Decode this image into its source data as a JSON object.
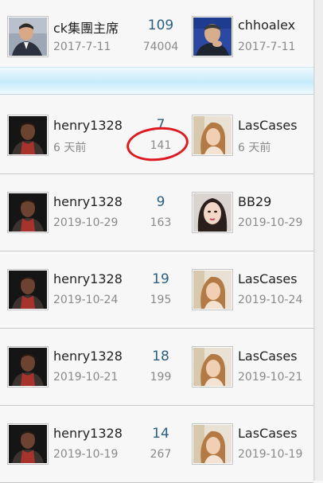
{
  "topics": [
    {
      "author": "ck集團主席",
      "author_date": "2017-7-11",
      "replies": "109",
      "views": "74004",
      "last_poster": "chhoalex",
      "last_date": "2017-7-11",
      "author_avatar": "businessman-avatar",
      "last_avatar": "businessman-hand-on-chin-avatar"
    },
    {
      "author": "henry1328",
      "author_date": "6 天前",
      "replies": "7",
      "views": "141",
      "last_poster": "LasCases",
      "last_date": "6 天前",
      "author_avatar": "man-avatar",
      "last_avatar": "woman-avatar"
    },
    {
      "author": "henry1328",
      "author_date": "2019-10-29",
      "replies": "9",
      "views": "163",
      "last_poster": "BB29",
      "last_date": "2019-10-29",
      "author_avatar": "man-avatar",
      "last_avatar": "woman-portrait-avatar"
    },
    {
      "author": "henry1328",
      "author_date": "2019-10-24",
      "replies": "19",
      "views": "195",
      "last_poster": "LasCases",
      "last_date": "2019-10-24",
      "author_avatar": "man-avatar",
      "last_avatar": "woman-avatar"
    },
    {
      "author": "henry1328",
      "author_date": "2019-10-21",
      "replies": "18",
      "views": "199",
      "last_poster": "LasCases",
      "last_date": "2019-10-21",
      "author_avatar": "man-avatar",
      "last_avatar": "woman-avatar"
    },
    {
      "author": "henry1328",
      "author_date": "2019-10-19",
      "replies": "14",
      "views": "267",
      "last_poster": "LasCases",
      "last_date": "2019-10-19",
      "author_avatar": "man-avatar",
      "last_avatar": "woman-avatar"
    }
  ],
  "colors": {
    "reply_count": "#2d5f85",
    "annotation_circle": "#e01920",
    "divider": "#c7ebfb"
  }
}
